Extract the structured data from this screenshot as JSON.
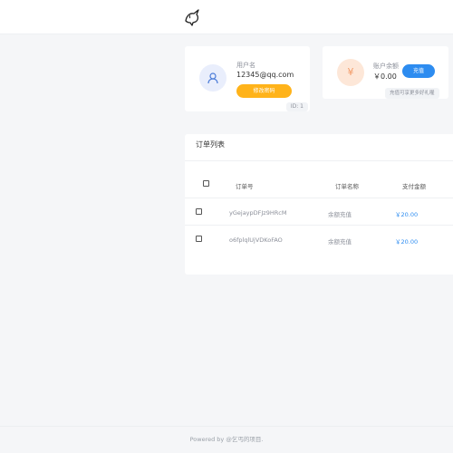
{
  "header": {
    "logo_icon": "unicorn-icon"
  },
  "user_card": {
    "label": "用户名",
    "email": "12345@qq.com",
    "edit_button": "修改密码",
    "id_text": "ID: 1",
    "avatar_icon": "user-icon"
  },
  "balance_card": {
    "label": "账户余额",
    "amount": "￥0.00",
    "recharge_button": "充值",
    "tip": "充值可享更多好礼喔",
    "currency_icon": "yen-icon"
  },
  "orders": {
    "title": "订单列表",
    "columns": [
      "订单号",
      "订单名称",
      "支付金额"
    ],
    "rows": [
      {
        "order_no": "yGejaypDFJz9HRcM",
        "name": "余额充值",
        "amount": "￥20.00"
      },
      {
        "order_no": "o6fplqlUjVDKoFAO",
        "name": "余额充值",
        "amount": "￥20.00"
      }
    ]
  },
  "footer": {
    "text": "Powered by @乞丐的项目."
  },
  "colors": {
    "accent": "#2d8cf0",
    "warning": "#ffb31a",
    "background": "#f5f6f8"
  }
}
